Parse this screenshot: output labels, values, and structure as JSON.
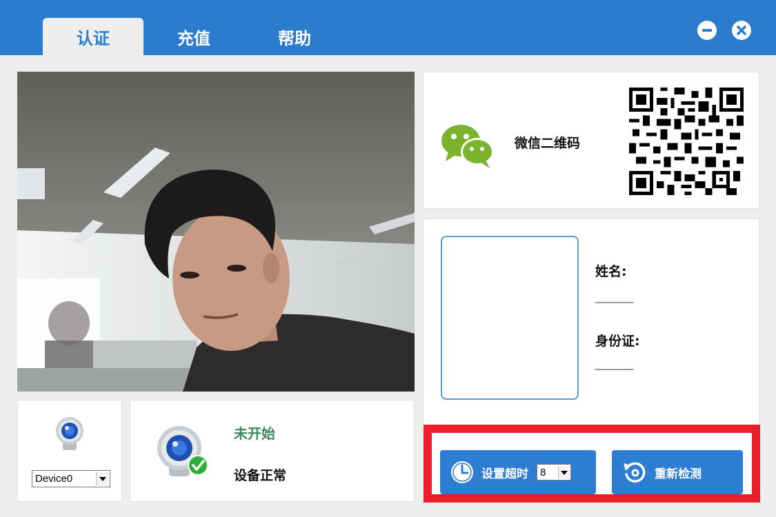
{
  "tabs": [
    {
      "label": "认证",
      "active": true
    },
    {
      "label": "充值",
      "active": false
    },
    {
      "label": "帮助",
      "active": false
    }
  ],
  "camera": {
    "content": "live webcam feed of a person in an office"
  },
  "device": {
    "selected": "Device0"
  },
  "status": {
    "title": "未开始",
    "text": "设备正常"
  },
  "wechat": {
    "label": "微信二维码"
  },
  "id_info": {
    "name_label": "姓名:",
    "name_value": "_________",
    "id_label": "身份证:",
    "id_value": "_________"
  },
  "actions": {
    "timeout_label": "设置超时",
    "timeout_value": "8",
    "recheck_label": "重新检测"
  },
  "colors": {
    "titlebar": "#2b7ccc",
    "button": "#2d7dd2",
    "highlight_frame": "#e8202b",
    "status_green": "#3a8a5a",
    "wechat_green": "#7bb32e"
  }
}
